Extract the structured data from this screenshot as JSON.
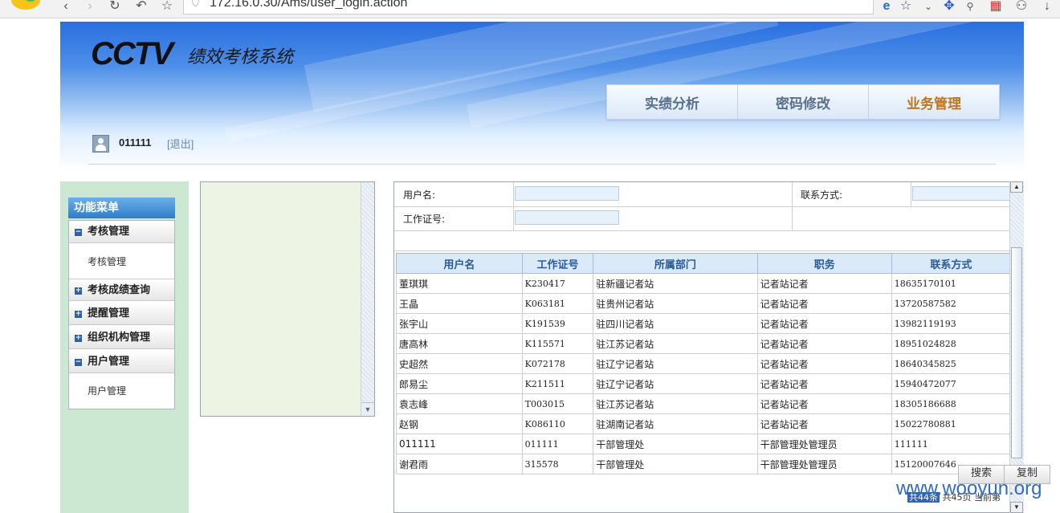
{
  "browser": {
    "url": "172.16.0.30/Ams/user_login.action",
    "icons": [
      "back-icon",
      "forward-icon",
      "reload-icon",
      "undo-icon",
      "star-icon",
      "shield-icon",
      "ie-icon",
      "bookmark-icon",
      "chevron-down-icon",
      "paw-icon",
      "search-icon",
      "apps-icon",
      "user-icon",
      "download-icon"
    ]
  },
  "header": {
    "logo": "CCTV",
    "subtitle": "绩效考核系统",
    "nav": [
      "实绩分析",
      "密码修改",
      "业务管理"
    ],
    "user": "011111",
    "logout": "[退出]"
  },
  "menu": {
    "title": "功能菜单",
    "groups": [
      {
        "label": "考核管理",
        "expanded": true,
        "items": [
          "考核管理"
        ]
      },
      {
        "label": "考核成绩查询",
        "expanded": false,
        "items": []
      },
      {
        "label": "提醒管理",
        "expanded": false,
        "items": []
      },
      {
        "label": "组织机构管理",
        "expanded": false,
        "items": []
      },
      {
        "label": "用户管理",
        "expanded": true,
        "items": [
          "用户管理"
        ]
      }
    ]
  },
  "search": {
    "username_label": "用户名:",
    "contact_label": "联系方式:",
    "idno_label": "工作证号:",
    "username_value": "",
    "contact_value": "",
    "idno_value": ""
  },
  "table": {
    "columns": [
      "用户名",
      "工作证号",
      "所属部门",
      "职务",
      "联系方式"
    ],
    "rows": [
      [
        "董琪琪",
        "K230417",
        "驻新疆记者站",
        "记者站记者",
        "18635170101"
      ],
      [
        "王晶",
        "K063181",
        "驻贵州记者站",
        "记者站记者",
        "13720587582"
      ],
      [
        "张宇山",
        "K191539",
        "驻四川记者站",
        "记者站记者",
        "13982119193"
      ],
      [
        "唐高林",
        "K115571",
        "驻江苏记者站",
        "记者站记者",
        "18951024828"
      ],
      [
        "史超然",
        "K072178",
        "驻辽宁记者站",
        "记者站记者",
        "18640345825"
      ],
      [
        "郎易尘",
        "K211511",
        "驻辽宁记者站",
        "记者站记者",
        "15940472077"
      ],
      [
        "袁志峰",
        "T003015",
        "驻江苏记者站",
        "记者站记者",
        "18305186688"
      ],
      [
        "赵钢",
        "K086110",
        "驻湖南记者站",
        "记者站记者",
        "15022780881"
      ],
      [
        "011111",
        "011111",
        "干部管理处",
        "干部管理处管理员",
        "111111"
      ],
      [
        "谢君雨",
        "315578",
        "干部管理处",
        "干部管理处管理员",
        "15120007646"
      ]
    ]
  },
  "buttons": {
    "search": "搜索",
    "copy": "复制"
  },
  "pager": {
    "total": "共44条",
    "pages": "共45页",
    "current": "当前第"
  },
  "watermark": "www.wooyun.org"
}
